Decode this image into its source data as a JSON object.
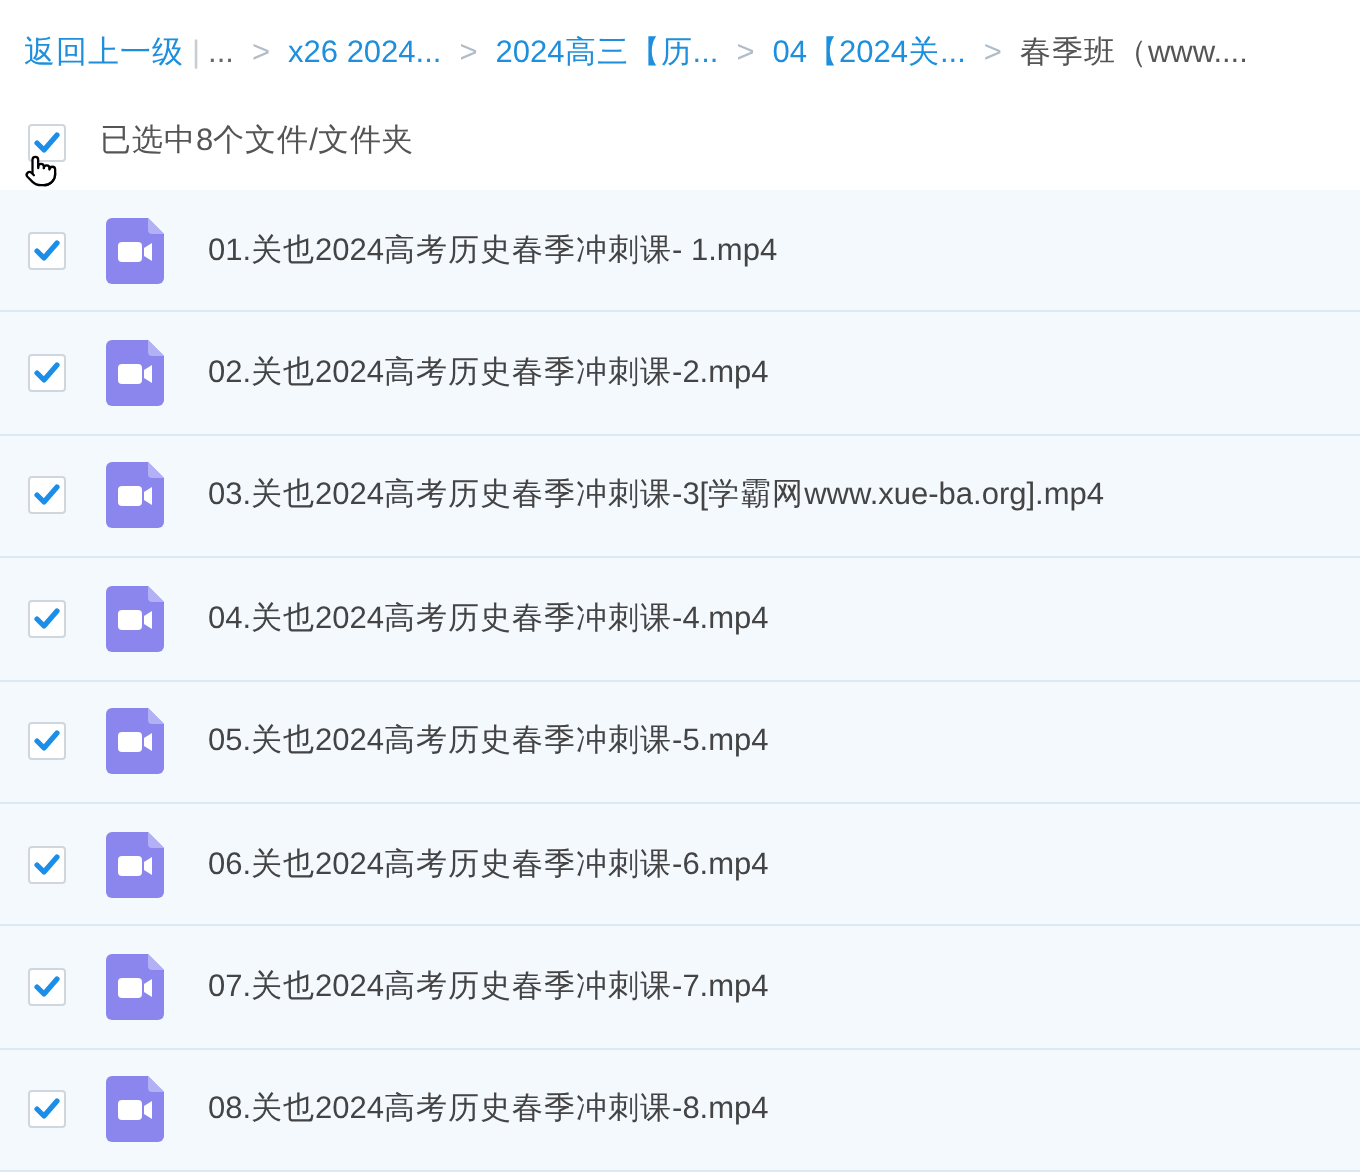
{
  "breadcrumb": [
    {
      "kind": "back",
      "label": "返回上一级",
      "separator_after": "|"
    },
    {
      "kind": "ellipsis",
      "label": "...",
      "separator_after": ">"
    },
    {
      "kind": "link",
      "label": "x26 2024...",
      "separator_after": ">"
    },
    {
      "kind": "link",
      "label": "2024高三【历...",
      "separator_after": ">"
    },
    {
      "kind": "link",
      "label": "04【2024关...",
      "separator_after": ">"
    },
    {
      "kind": "current",
      "label": "春季班（www...."
    }
  ],
  "select_all": {
    "checked": true,
    "label": "已选中8个文件/文件夹"
  },
  "files": [
    {
      "name": "01.关也2024高考历史春季冲刺课- 1.mp4",
      "checked": true,
      "selected": true
    },
    {
      "name": "02.关也2024高考历史春季冲刺课-2.mp4",
      "checked": true,
      "selected": true
    },
    {
      "name": "03.关也2024高考历史春季冲刺课-3[学霸网www.xue-ba.org].mp4",
      "checked": true,
      "selected": true
    },
    {
      "name": "04.关也2024高考历史春季冲刺课-4.mp4",
      "checked": true,
      "selected": true
    },
    {
      "name": "05.关也2024高考历史春季冲刺课-5.mp4",
      "checked": true,
      "selected": true
    },
    {
      "name": "06.关也2024高考历史春季冲刺课-6.mp4",
      "checked": true,
      "selected": true
    },
    {
      "name": "07.关也2024高考历史春季冲刺课-7.mp4",
      "checked": true,
      "selected": true
    },
    {
      "name": "08.关也2024高考历史春季冲刺课-8.mp4",
      "checked": true,
      "selected": true
    }
  ]
}
